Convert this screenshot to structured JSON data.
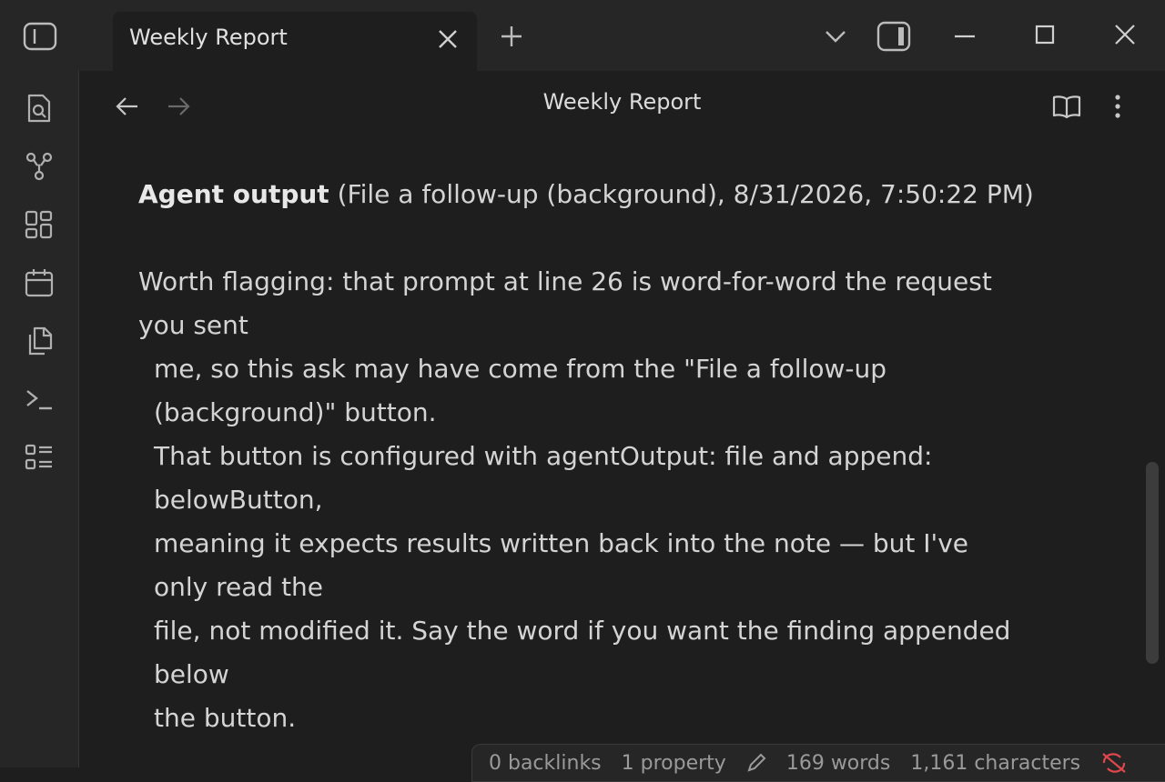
{
  "window": {
    "tab_title": "Weekly Report"
  },
  "view": {
    "title": "Weekly Report"
  },
  "content": {
    "heading_bold": "Agent output",
    "heading_rest": " (File a follow-up (background), 8/31/2026, 7:50:22 PM)",
    "lines": [
      "Worth flagging: that prompt at line 26 is word-for-word the request",
      "you sent",
      "me, so this ask may have come from the \"File a follow-up",
      "(background)\" button.",
      "That button is configured with agentOutput: file and append:",
      "belowButton,",
      "meaning it expects results written back into the note — but I've",
      "only read the",
      "file, not modified it. Say the word if you want the finding appended",
      "below",
      "the button."
    ]
  },
  "statusbar": {
    "backlinks": "0 backlinks",
    "properties": "1 property",
    "words": "169 words",
    "characters": "1,161 characters"
  },
  "colors": {
    "background": "#1e1e1e",
    "titlebar": "#262626",
    "sync_error": "#e0474c"
  }
}
